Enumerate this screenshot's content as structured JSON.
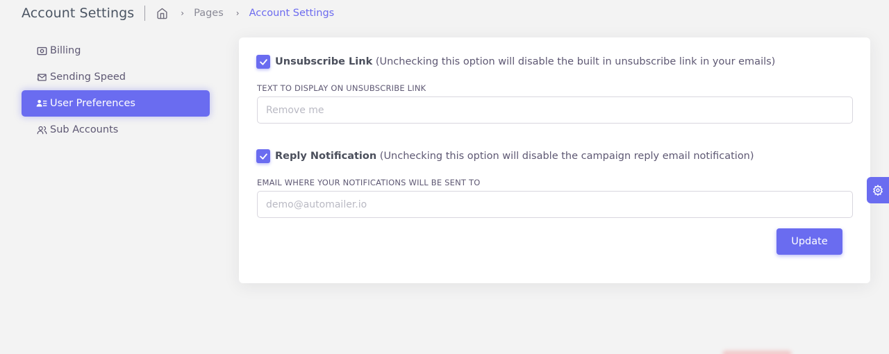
{
  "header": {
    "title": "Account Settings",
    "breadcrumb": [
      "Pages",
      "Account Settings"
    ]
  },
  "sidebar": {
    "items": [
      {
        "label": "Billing",
        "icon": "billing-icon",
        "active": false
      },
      {
        "label": "Sending Speed",
        "icon": "mail-speed-icon",
        "active": false
      },
      {
        "label": "User Preferences",
        "icon": "user-list-icon",
        "active": true
      },
      {
        "label": "Sub Accounts",
        "icon": "users-icon",
        "active": false
      }
    ]
  },
  "preferences": {
    "unsubscribe": {
      "checked": true,
      "title": "Unsubscribe Link",
      "description": "(Unchecking this option will disable the built in unsubscribe link in your emails)",
      "field_label": "TEXT TO DISPLAY ON UNSUBSCRIBE LINK",
      "placeholder": "Remove me",
      "value": ""
    },
    "reply_notification": {
      "checked": true,
      "title": "Reply Notification",
      "description": "(Unchecking this option will disable the campaign reply email notification)",
      "field_label": "EMAIL WHERE YOUR NOTIFICATIONS WILL BE SENT TO",
      "placeholder": "demo@automailer.io",
      "value": ""
    },
    "update_label": "Update"
  },
  "colors": {
    "primary": "#6a6cf0",
    "background": "#f3f3f3",
    "text": "#5e5873"
  }
}
